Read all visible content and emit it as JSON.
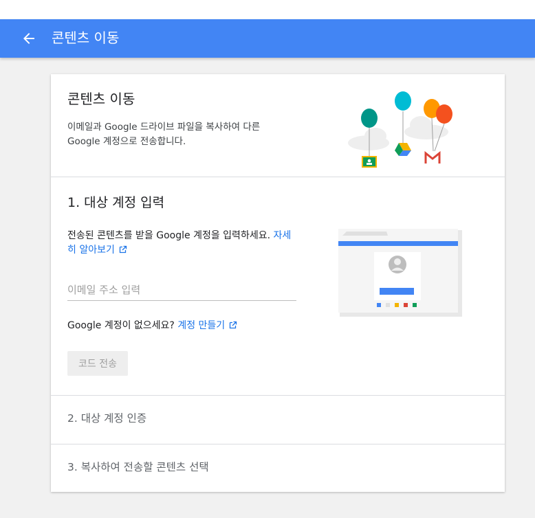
{
  "appbar": {
    "back_icon": "arrow-back-icon",
    "title": "콘텐츠 이동"
  },
  "header": {
    "title": "콘텐츠 이동",
    "description": "이메일과 Google 드라이브 파일을 복사하여 다른 Google 계정으로 전송합니다.",
    "illustration_icons": [
      "google-classroom-icon",
      "google-drive-icon",
      "gmail-icon"
    ]
  },
  "step1": {
    "title": "1. 대상 계정 입력",
    "description": "전송된 콘텐츠를 받을 Google 계정을 입력하세요.",
    "learn_more_link": "자세히 알아보기",
    "email_value": "",
    "email_placeholder": "이메일 주소 입력",
    "no_account_text": "Google 계정이 없으세요?",
    "create_account_link": "계정 만들기",
    "send_code_button": "코드 전송"
  },
  "step2": {
    "title": "2. 대상 계정 인증"
  },
  "step3": {
    "title": "3. 복사하여 전송할 콘텐츠 선택"
  },
  "colors": {
    "appbar": "#4285f4",
    "link": "#1a73e8",
    "background": "#f1f1f1"
  }
}
